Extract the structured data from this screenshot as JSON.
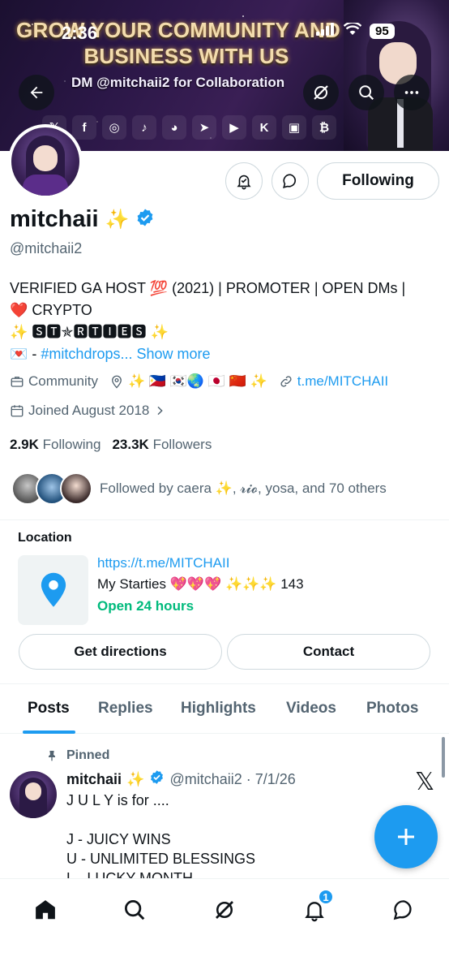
{
  "status_bar": {
    "time": "2:36",
    "battery": "95"
  },
  "banner": {
    "line1": "GROW YOUR COMMUNITY AND",
    "line2": "BUSINESS WITH US",
    "line3": "DM @mitchaii2 for Collaboration",
    "social_icons": [
      "x-icon",
      "facebook-icon",
      "instagram-icon",
      "tiktok-icon",
      "discord-icon",
      "telegram-icon",
      "youtube-icon",
      "kick-icon",
      "twitch-icon",
      "bitcoin-icon"
    ],
    "social_glyphs": [
      "𝕏",
      "f",
      "◎",
      "♪",
      "◕",
      "➤",
      "▶",
      "K",
      "▣",
      "₿"
    ]
  },
  "profile": {
    "display_name": "mitchaii",
    "sparkle": "✨",
    "handle": "@mitchaii2",
    "follow_button": "Following",
    "bio_line1": "VERIFIED GA HOST 💯 (2021) | PROMOTER | OPEN DMs |",
    "bio_line2": "❤️ CRYPTO",
    "bio_line3": "✨ 🆂🆃✯🆁🆃🅸🅴🆂 ✨",
    "bio_line4_prefix": "💌 - ",
    "bio_line4_link": "#mitchdrops...",
    "show_more": "Show more",
    "category": "Community",
    "location": "✨ 🇵🇭 🇰🇷🌏 🇯🇵 🇨🇳 ✨",
    "website": "t.me/MITCHAII",
    "joined": "Joined August 2018",
    "following_count": "2.9K",
    "following_label": "Following",
    "followers_count": "23.3K",
    "followers_label": "Followers",
    "followed_by": "Followed by caera ✨, 𝓻𝓲𝓸, yosa, and 70 others"
  },
  "location_card": {
    "title": "Location",
    "link": "https://t.me/MITCHAII",
    "name": "My Starties 💖💖💖 ✨✨✨ 143",
    "hours": "Open 24 hours",
    "directions_button": "Get directions",
    "contact_button": "Contact"
  },
  "tabs": [
    "Posts",
    "Replies",
    "Highlights",
    "Videos",
    "Photos"
  ],
  "pinned_post": {
    "pinned_label": "Pinned",
    "name": "mitchaii",
    "sparkle": "✨",
    "meta": "@mitchaii2 · 7/1/26",
    "body": "J U L Y is for ....\n\nJ - JUICY WINS\nU - UNLIMITED BLESSINGS\nL - LUCKY MONTH"
  },
  "notifications_badge": "1",
  "colors": {
    "accent": "#1d9bf0",
    "success": "#00ba7c",
    "muted": "#536471"
  }
}
